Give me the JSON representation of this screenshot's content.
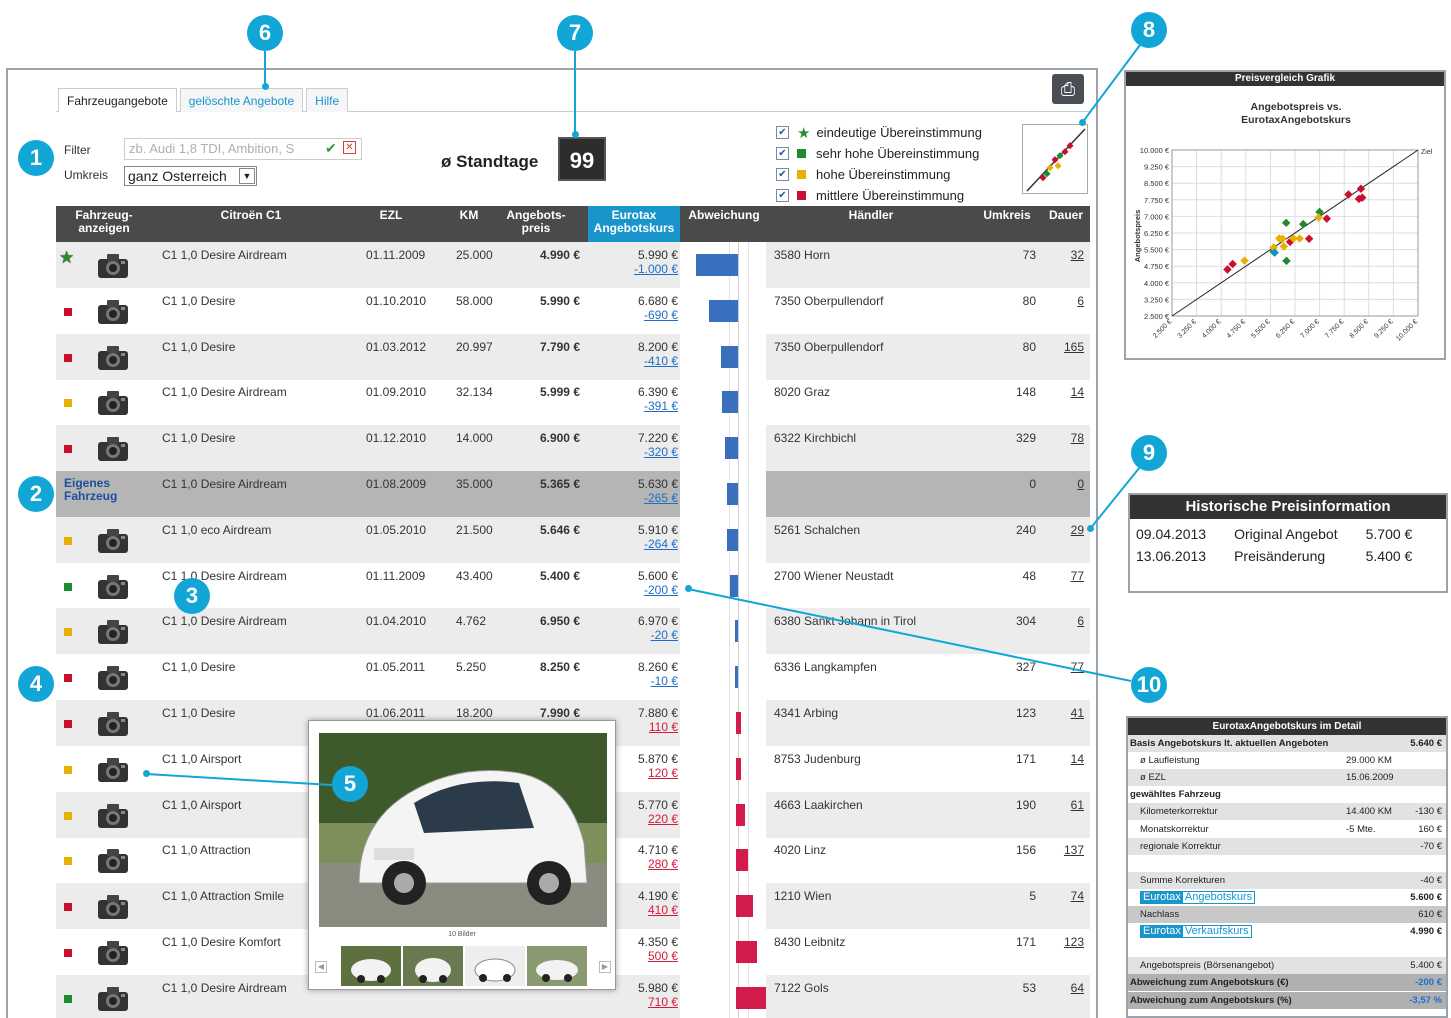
{
  "tabs": [
    "Fahrzeugangebote",
    "gelöschte Angebote",
    "Hilfe"
  ],
  "filter": {
    "label": "Filter",
    "placeholder": "zb. Audi 1,8 TDI, Ambition, S",
    "umkreis_label": "Umkreis",
    "umkreis_value": "ganz Osterreich"
  },
  "standtage": {
    "label": "ø Standtage",
    "value": "99"
  },
  "legend": [
    {
      "label": "eindeutige Übereinstimmung",
      "marker": "star",
      "color": "#2e8b2e"
    },
    {
      "label": "sehr hohe Übereinstimmung",
      "marker": "square",
      "color": "#1e8c2e"
    },
    {
      "label": "hohe Übereinstimmung",
      "marker": "square",
      "color": "#e8b000"
    },
    {
      "label": "mittlere Übereinstimmung",
      "marker": "square",
      "color": "#c8102e"
    }
  ],
  "columns": {
    "anzeigen": "Fahrzeug-\nanzeigen",
    "model": "Citroën C1",
    "ezl": "EZL",
    "km": "KM",
    "preis": "Angebots-\npreis",
    "eurotax": "Eurotax\nAngebotskurs",
    "abw": "Abweichung",
    "haendler": "Händler",
    "umkreis": "Umkreis",
    "dauer": "Dauer"
  },
  "own_label": "Eigenes\nFahrzeug",
  "rows": [
    {
      "marker": "star",
      "color": "#2e8b2e",
      "model": "C1 1,0 Desire Airdream",
      "ezl": "01.11.2009",
      "km": "25.000",
      "preis": "4.990 €",
      "eurotax": "5.990 €",
      "diff": "-1.000 €",
      "haendler": "3580 Horn",
      "umkreis": "73",
      "dauer": "32",
      "abw": -1000
    },
    {
      "marker": "square",
      "color": "#c8102e",
      "model": "C1 1,0 Desire",
      "ezl": "01.10.2010",
      "km": "58.000",
      "preis": "5.990 €",
      "eurotax": "6.680 €",
      "diff": "-690 €",
      "haendler": "7350 Oberpullendorf",
      "umkreis": "80",
      "dauer": "6",
      "abw": -690
    },
    {
      "marker": "square",
      "color": "#c8102e",
      "model": "C1 1,0 Desire",
      "ezl": "01.03.2012",
      "km": "20.997",
      "preis": "7.790 €",
      "eurotax": "8.200 €",
      "diff": "-410 €",
      "haendler": "7350 Oberpullendorf",
      "umkreis": "80",
      "dauer": "165",
      "abw": -410
    },
    {
      "marker": "square",
      "color": "#e8b000",
      "model": "C1 1,0 Desire Airdream",
      "ezl": "01.09.2010",
      "km": "32.134",
      "preis": "5.999 €",
      "eurotax": "6.390 €",
      "diff": "-391 €",
      "haendler": "8020 Graz",
      "umkreis": "148",
      "dauer": "14",
      "abw": -391
    },
    {
      "marker": "square",
      "color": "#c8102e",
      "model": "C1 1,0 Desire",
      "ezl": "01.12.2010",
      "km": "14.000",
      "preis": "6.900 €",
      "eurotax": "7.220 €",
      "diff": "-320 €",
      "haendler": "6322 Kirchbichl",
      "umkreis": "329",
      "dauer": "78",
      "abw": -320
    },
    {
      "marker": "own",
      "color": "",
      "model": "C1 1,0 Desire Airdream",
      "ezl": "01.08.2009",
      "km": "35.000",
      "preis": "5.365 €",
      "eurotax": "5.630 €",
      "diff": "-265 €",
      "haendler": "",
      "umkreis": "0",
      "dauer": "0",
      "abw": -265
    },
    {
      "marker": "square",
      "color": "#e8b000",
      "model": "C1 1,0 eco Airdream",
      "ezl": "01.05.2010",
      "km": "21.500",
      "preis": "5.646 €",
      "eurotax": "5.910 €",
      "diff": "-264 €",
      "haendler": "5261 Schalchen",
      "umkreis": "240",
      "dauer": "29",
      "abw": -264
    },
    {
      "marker": "square",
      "color": "#1e8c2e",
      "model": "C1 1,0 Desire Airdream",
      "ezl": "01.11.2009",
      "km": "43.400",
      "preis": "5.400 €",
      "eurotax": "5.600 €",
      "diff": "-200 €",
      "haendler": "2700 Wiener Neustadt",
      "umkreis": "48",
      "dauer": "77",
      "abw": -200
    },
    {
      "marker": "square",
      "color": "#e8b000",
      "model": "C1 1,0 Desire Airdream",
      "ezl": "01.04.2010",
      "km": "4.762",
      "preis": "6.950 €",
      "eurotax": "6.970 €",
      "diff": "-20 €",
      "haendler": "6380 Sankt Johann in Tirol",
      "umkreis": "304",
      "dauer": "6",
      "abw": -20
    },
    {
      "marker": "square",
      "color": "#c8102e",
      "model": "C1 1,0 Desire",
      "ezl": "01.05.2011",
      "km": "5.250",
      "preis": "8.250 €",
      "eurotax": "8.260 €",
      "diff": "-10 €",
      "haendler": "6336 Langkampfen",
      "umkreis": "327",
      "dauer": "77",
      "abw": -10
    },
    {
      "marker": "square",
      "color": "#c8102e",
      "model": "C1 1,0 Desire",
      "ezl": "01.06.2011",
      "km": "18.200",
      "preis": "7.990 €",
      "eurotax": "7.880 €",
      "diff": "110 €",
      "haendler": "4341 Arbing",
      "umkreis": "123",
      "dauer": "41",
      "abw": 110
    },
    {
      "marker": "square",
      "color": "#e8b000",
      "model": "C1 1,0 Airsport",
      "ezl": "",
      "km": "",
      "preis": "",
      "eurotax": "5.870 €",
      "diff": "120 €",
      "haendler": "8753 Judenburg",
      "umkreis": "171",
      "dauer": "14",
      "abw": 120
    },
    {
      "marker": "square",
      "color": "#e8b000",
      "model": "C1 1,0 Airsport",
      "ezl": "",
      "km": "",
      "preis": "",
      "eurotax": "5.770 €",
      "diff": "220 €",
      "haendler": "4663 Laakirchen",
      "umkreis": "190",
      "dauer": "61",
      "abw": 220
    },
    {
      "marker": "square",
      "color": "#e8b000",
      "model": "C1 1,0 Attraction",
      "ezl": "",
      "km": "",
      "preis": "",
      "eurotax": "4.710 €",
      "diff": "280 €",
      "haendler": "4020 Linz",
      "umkreis": "156",
      "dauer": "137",
      "abw": 280
    },
    {
      "marker": "square",
      "color": "#c8102e",
      "model": "C1 1,0 Attraction Smile",
      "ezl": "",
      "km": "",
      "preis": "",
      "eurotax": "4.190 €",
      "diff": "410 €",
      "haendler": "1210 Wien",
      "umkreis": "5",
      "dauer": "74",
      "abw": 410
    },
    {
      "marker": "square",
      "color": "#c8102e",
      "model": "C1 1,0 Desire Komfort",
      "ezl": "",
      "km": "",
      "preis": "",
      "eurotax": "4.350 €",
      "diff": "500 €",
      "haendler": "8430 Leibnitz",
      "umkreis": "171",
      "dauer": "123",
      "abw": 500
    },
    {
      "marker": "square",
      "color": "#1e8c2e",
      "model": "C1 1,0 Desire Airdream",
      "ezl": "",
      "km": "",
      "preis": "",
      "eurotax": "5.980 €",
      "diff": "710 €",
      "haendler": "7122 Gols",
      "umkreis": "53",
      "dauer": "64",
      "abw": 710
    }
  ],
  "popup": {
    "caption": "10 Bilder"
  },
  "callouts": [
    "1",
    "2",
    "3",
    "4",
    "5",
    "6",
    "7",
    "8",
    "9",
    "10"
  ],
  "chart": {
    "panel_title": "Preisvergleich Grafik",
    "title": "Angebotspreis vs.\nEurotaxAngebotskurs",
    "ylabel": "Angebotspreis",
    "ziel": "Ziel",
    "yticks": [
      "10.000 €",
      "9.250 €",
      "8.500 €",
      "7.750 €",
      "7.000 €",
      "6.250 €",
      "5.500 €",
      "4.750 €",
      "4.000 €",
      "3.250 €",
      "2.500 €"
    ],
    "xticks": [
      "2.500 €",
      "3.250 €",
      "4.000 €",
      "4.750 €",
      "5.500 €",
      "6.250 €",
      "7.000 €",
      "7.750 €",
      "8.500 €",
      "9.250 €",
      "10.000 €"
    ]
  },
  "chart_data": {
    "type": "scatter",
    "title": "Angebotspreis vs.\nEurotaxAngebotskurs",
    "xlabel": "",
    "ylabel": "Angebotspreis",
    "xlim": [
      2500,
      10000
    ],
    "ylim": [
      2500,
      10000
    ],
    "grid": true,
    "series": [
      {
        "color": "#1e8c2e",
        "points": [
          [
            5990,
            4990
          ],
          [
            5600,
            5400
          ],
          [
            5980,
            6710
          ],
          [
            7000,
            7200
          ],
          [
            6500,
            6650
          ]
        ]
      },
      {
        "color": "#c8102e",
        "points": [
          [
            6680,
            5990
          ],
          [
            8200,
            7790
          ],
          [
            7220,
            6900
          ],
          [
            8260,
            8250
          ],
          [
            7880,
            7990
          ],
          [
            4190,
            4600
          ],
          [
            4350,
            4850
          ],
          [
            6100,
            5850
          ],
          [
            8300,
            7850
          ]
        ]
      },
      {
        "color": "#e8b000",
        "points": [
          [
            6390,
            5999
          ],
          [
            5910,
            5646
          ],
          [
            6970,
            6950
          ],
          [
            5870,
            5990
          ],
          [
            5770,
            6000
          ],
          [
            4710,
            5000
          ],
          [
            5600,
            5600
          ],
          [
            6200,
            6000
          ]
        ]
      },
      {
        "color": "#1a8fc4",
        "points": [
          [
            5630,
            5365
          ]
        ]
      }
    ]
  },
  "hist": {
    "title": "Historische Preisinformation",
    "rows": [
      [
        "09.04.2013",
        "Original Angebot",
        "5.700 €"
      ],
      [
        "13.06.2013",
        "Preisänderung",
        "5.400 €"
      ]
    ]
  },
  "detail": {
    "title": "EurotaxAngebotskurs im Detail",
    "rows": [
      {
        "label": "Basis Angebotskurs lt. aktuellen Angeboten",
        "mid": "",
        "val": "5.640 €",
        "bold": true,
        "bg": "#e2e2e2",
        "indent": 0
      },
      {
        "label": "ø Laufleistung",
        "mid": "29.000 KM",
        "val": "",
        "bold": false,
        "bg": "#fff",
        "indent": 1
      },
      {
        "label": "ø EZL",
        "mid": "15.06.2009",
        "val": "",
        "bold": false,
        "bg": "#e2e2e2",
        "indent": 1
      },
      {
        "label": "gewähltes Fahrzeug",
        "mid": "",
        "val": "",
        "bold": true,
        "bg": "#fff",
        "indent": 0
      },
      {
        "label": "Kilometerkorrektur",
        "mid": "14.400 KM",
        "val": "-130 €",
        "bold": false,
        "bg": "#e2e2e2",
        "indent": 1
      },
      {
        "label": "Monatskorrektur",
        "mid": "-5 Mte.",
        "val": "160 €",
        "bold": false,
        "bg": "#fff",
        "indent": 1
      },
      {
        "label": "regionale Korrektur",
        "mid": "",
        "val": "-70 €",
        "bold": false,
        "bg": "#e2e2e2",
        "indent": 1
      },
      {
        "label": "",
        "mid": "",
        "val": "",
        "bold": false,
        "bg": "#fff",
        "indent": 1
      },
      {
        "label": "Summe Korrekturen",
        "mid": "",
        "val": "-40 €",
        "bold": false,
        "bg": "#e2e2e2",
        "indent": 1
      },
      {
        "label": "Eurotax|Angebotskurs",
        "mid": "",
        "val": "5.600 €",
        "bold": true,
        "bg": "#fff",
        "indent": 1,
        "brand": true
      },
      {
        "label": "Nachlass",
        "mid": "",
        "val": "610 €",
        "bold": false,
        "bg": "#c8c8c8",
        "indent": 1
      },
      {
        "label": "Eurotax|Verkaufskurs",
        "mid": "",
        "val": "4.990 €",
        "bold": true,
        "bg": "#fff",
        "indent": 1,
        "brand": true
      },
      {
        "label": "",
        "mid": "",
        "val": "",
        "bold": false,
        "bg": "#fff",
        "indent": 1
      },
      {
        "label": "Angebotspreis (Börsenangebot)",
        "mid": "",
        "val": "5.400 €",
        "bold": false,
        "bg": "#e2e2e2",
        "indent": 1
      },
      {
        "label": "Abweichung zum Angebotskurs (€)",
        "mid": "",
        "val": "-200 €",
        "bold": true,
        "bg": "#b0b0b0",
        "indent": 0,
        "blueval": true
      },
      {
        "label": "Abweichung zum Angebotskurs (%)",
        "mid": "",
        "val": "-3,57 %",
        "bold": true,
        "bg": "#b0b0b0",
        "indent": 0,
        "blueval": true
      }
    ]
  }
}
